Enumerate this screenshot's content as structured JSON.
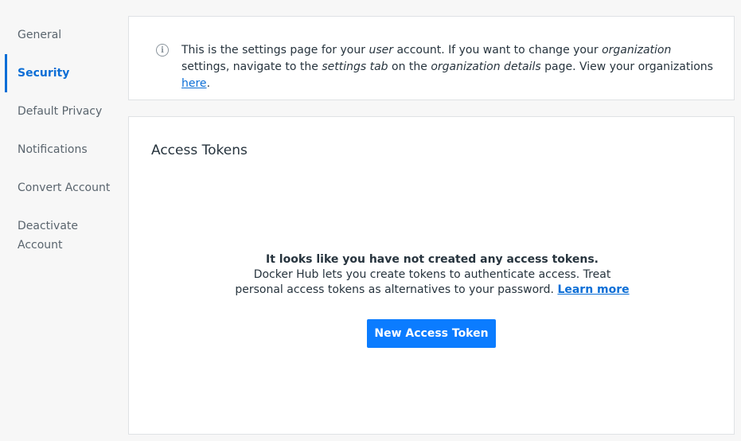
{
  "sidebar": {
    "items": [
      {
        "label": "General"
      },
      {
        "label": "Security"
      },
      {
        "label": "Default Privacy"
      },
      {
        "label": "Notifications"
      },
      {
        "label": "Convert Account"
      },
      {
        "label": "Deactivate Account"
      }
    ],
    "active_index": 1
  },
  "info": {
    "icon": "info-icon",
    "part1": "This is the settings page for your ",
    "em1": "user",
    "part2": " account. If you want to change your ",
    "em2": "organization",
    "part3": " settings, navigate to the ",
    "em3": "settings tab",
    "part4": " on the ",
    "em4": "organization details",
    "part5": " page. View your organizations ",
    "link": "here",
    "part6": "."
  },
  "tokens": {
    "title": "Access Tokens",
    "empty_heading": "It looks like you have not created any access tokens.",
    "empty_desc": "Docker Hub lets you create tokens to authenticate access. Treat personal access tokens as alternatives to your password.",
    "learn_more": "Learn more",
    "new_button": "New Access Token"
  },
  "colors": {
    "accent": "#0b6ed6",
    "button": "#0b7cff"
  }
}
